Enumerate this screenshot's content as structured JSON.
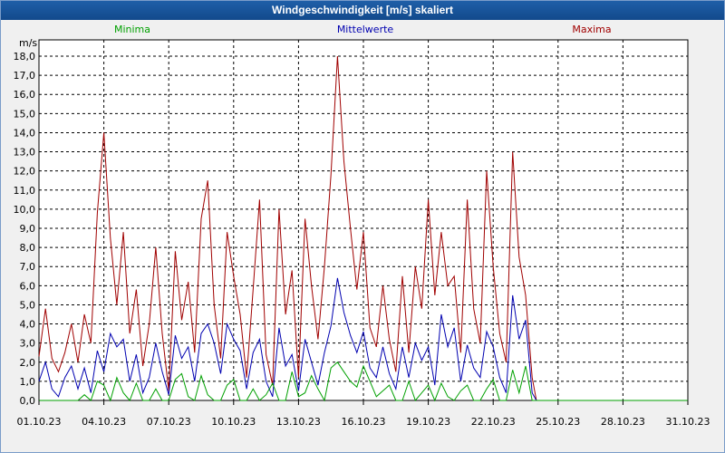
{
  "window": {
    "title": "Windgeschwindigkeit [m/s] skaliert"
  },
  "colors": {
    "minima": "#00a000",
    "mittelwerte": "#0000b0",
    "maxima": "#a00000",
    "grid": "#000000",
    "plot_bg": "#ffffff"
  },
  "chart_data": {
    "type": "line",
    "title": "Windgeschwindigkeit [m/s] skaliert",
    "ylabel": "m/s",
    "xlabel": "",
    "ylim": [
      0,
      18
    ],
    "y_ticks": [
      "0,0",
      "1,0",
      "2,0",
      "3,0",
      "4,0",
      "5,0",
      "6,0",
      "7,0",
      "8,0",
      "9,0",
      "10,0",
      "11,0",
      "12,0",
      "13,0",
      "14,0",
      "15,0",
      "16,0",
      "17,0",
      "18,0"
    ],
    "x_ticks": [
      "01.10.23",
      "04.10.23",
      "07.10.23",
      "10.10.23",
      "13.10.23",
      "16.10.23",
      "19.10.23",
      "22.10.23",
      "25.10.23",
      "28.10.23",
      "31.10.23"
    ],
    "x_range_days": [
      0,
      30
    ],
    "grid": true,
    "legend_placement": "top",
    "series": [
      {
        "name": "Minima",
        "color_key": "minima",
        "x": [
          0,
          0.3,
          0.6,
          0.9,
          1.2,
          1.5,
          1.8,
          2.1,
          2.4,
          2.7,
          3.0,
          3.3,
          3.6,
          3.9,
          4.2,
          4.5,
          4.8,
          5.1,
          5.4,
          5.7,
          6.0,
          6.3,
          6.6,
          6.9,
          7.2,
          7.5,
          7.8,
          8.1,
          8.4,
          8.7,
          9.0,
          9.3,
          9.6,
          9.9,
          10.2,
          10.5,
          10.8,
          11.1,
          11.4,
          11.7,
          12.0,
          12.3,
          12.6,
          12.9,
          13.2,
          13.5,
          13.8,
          14.1,
          14.4,
          14.7,
          15.0,
          15.3,
          15.6,
          15.9,
          16.2,
          16.5,
          16.8,
          17.1,
          17.4,
          17.7,
          18.0,
          18.3,
          18.6,
          18.9,
          19.2,
          19.5,
          19.8,
          20.1,
          20.4,
          20.7,
          21.0,
          21.3,
          21.6,
          21.9,
          22.2,
          22.5,
          22.8,
          23,
          24,
          25,
          26,
          27,
          28,
          29,
          30
        ],
        "values": [
          0,
          0,
          0,
          0,
          0,
          0,
          0,
          0.3,
          0,
          1.0,
          0.8,
          0,
          1.2,
          0.4,
          0,
          0.9,
          0,
          0,
          0.6,
          0,
          0,
          1.1,
          1.4,
          0.2,
          0,
          1.3,
          0.3,
          0,
          0,
          0.8,
          1.1,
          0,
          0,
          0.6,
          0,
          0.3,
          0.9,
          0,
          0,
          1.5,
          0.2,
          0.4,
          1.3,
          0.6,
          0,
          1.7,
          2.0,
          1.5,
          1.0,
          0.7,
          1.8,
          1.0,
          0.2,
          0.5,
          0.8,
          0,
          0,
          1.0,
          0,
          0.4,
          0.8,
          0,
          0.9,
          0.2,
          0,
          0.5,
          0.8,
          0,
          0,
          0.6,
          1.1,
          0,
          0,
          1.6,
          0.4,
          1.8,
          0,
          0,
          0,
          0,
          0,
          0,
          0,
          0,
          0
        ]
      },
      {
        "name": "Mittelwerte",
        "color_key": "mittelwerte",
        "x": [
          0,
          0.3,
          0.6,
          0.9,
          1.2,
          1.5,
          1.8,
          2.1,
          2.4,
          2.7,
          3.0,
          3.3,
          3.6,
          3.9,
          4.2,
          4.5,
          4.8,
          5.1,
          5.4,
          5.7,
          6.0,
          6.3,
          6.6,
          6.9,
          7.2,
          7.5,
          7.8,
          8.1,
          8.4,
          8.7,
          9.0,
          9.3,
          9.6,
          9.9,
          10.2,
          10.5,
          10.8,
          11.1,
          11.4,
          11.7,
          12.0,
          12.3,
          12.6,
          12.9,
          13.2,
          13.5,
          13.8,
          14.1,
          14.4,
          14.7,
          15.0,
          15.3,
          15.6,
          15.9,
          16.2,
          16.5,
          16.8,
          17.1,
          17.4,
          17.7,
          18.0,
          18.3,
          18.6,
          18.9,
          19.2,
          19.5,
          19.8,
          20.1,
          20.4,
          20.7,
          21.0,
          21.3,
          21.6,
          21.9,
          22.2,
          22.5,
          22.8,
          23,
          24,
          25,
          26,
          27,
          28,
          29,
          30
        ],
        "values": [
          1.0,
          2.0,
          0.6,
          0.2,
          1.2,
          1.8,
          0.6,
          1.7,
          0.4,
          2.6,
          1.5,
          3.5,
          2.8,
          3.2,
          1.0,
          2.4,
          0.4,
          1.2,
          3.0,
          1.5,
          0.3,
          3.4,
          2.2,
          2.8,
          1.0,
          3.5,
          4.0,
          3.0,
          1.4,
          4.0,
          3.2,
          2.6,
          0.6,
          2.5,
          3.2,
          1.0,
          0.2,
          3.8,
          1.8,
          2.4,
          0.5,
          3.2,
          2.0,
          0.8,
          2.5,
          3.9,
          6.4,
          4.6,
          3.4,
          2.5,
          3.6,
          1.7,
          1.2,
          2.8,
          1.4,
          0.6,
          2.8,
          1.2,
          3.0,
          2.1,
          2.8,
          0.8,
          4.5,
          2.8,
          3.8,
          1.0,
          2.9,
          1.7,
          1.2,
          3.6,
          2.8,
          1.2,
          0.4,
          5.5,
          3.2,
          4.2,
          0.4,
          0,
          0,
          0,
          0,
          0,
          0,
          0,
          0
        ]
      },
      {
        "name": "Maxima",
        "color_key": "maxima",
        "x": [
          0,
          0.3,
          0.6,
          0.9,
          1.2,
          1.5,
          1.8,
          2.1,
          2.4,
          2.7,
          3.0,
          3.3,
          3.6,
          3.9,
          4.2,
          4.5,
          4.8,
          5.1,
          5.4,
          5.7,
          6.0,
          6.3,
          6.6,
          6.9,
          7.2,
          7.5,
          7.8,
          8.1,
          8.4,
          8.7,
          9.0,
          9.3,
          9.6,
          9.9,
          10.2,
          10.5,
          10.8,
          11.1,
          11.4,
          11.7,
          12.0,
          12.3,
          12.6,
          12.9,
          13.2,
          13.5,
          13.8,
          14.1,
          14.4,
          14.7,
          15.0,
          15.3,
          15.6,
          15.9,
          16.2,
          16.5,
          16.8,
          17.1,
          17.4,
          17.7,
          18.0,
          18.3,
          18.6,
          18.9,
          19.2,
          19.5,
          19.8,
          20.1,
          20.4,
          20.7,
          21.0,
          21.3,
          21.6,
          21.9,
          22.2,
          22.5,
          22.8,
          23,
          24,
          25,
          26,
          27,
          28,
          29,
          30
        ],
        "values": [
          2.3,
          4.8,
          2.2,
          1.5,
          2.5,
          4.0,
          2.0,
          4.5,
          3.0,
          9.8,
          14.0,
          8.5,
          5.0,
          8.8,
          3.5,
          5.8,
          1.8,
          4.0,
          8.0,
          3.5,
          0.5,
          7.8,
          4.2,
          6.2,
          2.5,
          9.5,
          11.5,
          5.0,
          2.2,
          8.8,
          6.5,
          4.5,
          1.2,
          5.8,
          10.5,
          2.4,
          0.8,
          10.0,
          4.5,
          6.8,
          1.2,
          9.5,
          6.0,
          3.2,
          7.0,
          11.8,
          18.0,
          12.5,
          9.0,
          5.8,
          8.8,
          3.8,
          2.8,
          6.0,
          3.2,
          1.5,
          6.5,
          2.5,
          7.0,
          4.8,
          10.5,
          5.5,
          8.8,
          6.0,
          6.5,
          2.5,
          10.5,
          4.8,
          3.0,
          12.0,
          7.0,
          3.5,
          2.0,
          13.0,
          7.5,
          5.5,
          1.2,
          0,
          0,
          0,
          0,
          0,
          0,
          0,
          0
        ]
      }
    ]
  }
}
